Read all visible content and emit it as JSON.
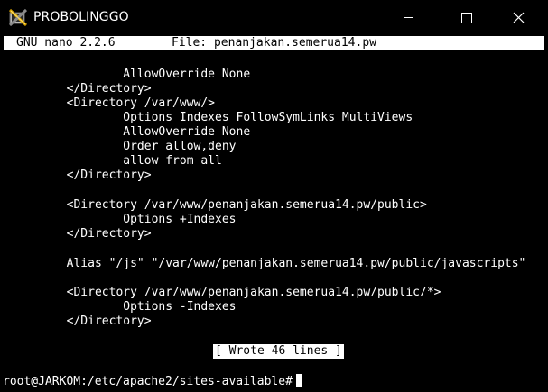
{
  "window": {
    "title": "PROBOLINGGO",
    "app_icon": "putty-icon",
    "controls": [
      "minimize-icon",
      "maximize-icon",
      "close-icon"
    ]
  },
  "nano": {
    "version": "GNU nano 2.2.6",
    "file": "File: penanjakan.semerua14.pw",
    "status": "[ Wrote 46 lines ]"
  },
  "lines": [
    "          AllowOverride None",
    "  </Directory>",
    "  <Directory /var/www/>",
    "          Options Indexes FollowSymLinks MultiViews",
    "          AllowOverride None",
    "          Order allow,deny",
    "          allow from all",
    "  </Directory>",
    "",
    "  <Directory /var/www/penanjakan.semerua14.pw/public>",
    "          Options +Indexes",
    "  </Directory>",
    "",
    "  Alias \"/js\" \"/var/www/penanjakan.semerua14.pw/public/javascripts\"",
    "",
    "  <Directory /var/www/penanjakan.semerua14.pw/public/*>",
    "          Options -Indexes",
    "  </Directory>"
  ],
  "prompt": "root@JARKOM:/etc/apache2/sites-available#",
  "colors": {
    "background": "#000000",
    "foreground": "#ffffff"
  }
}
